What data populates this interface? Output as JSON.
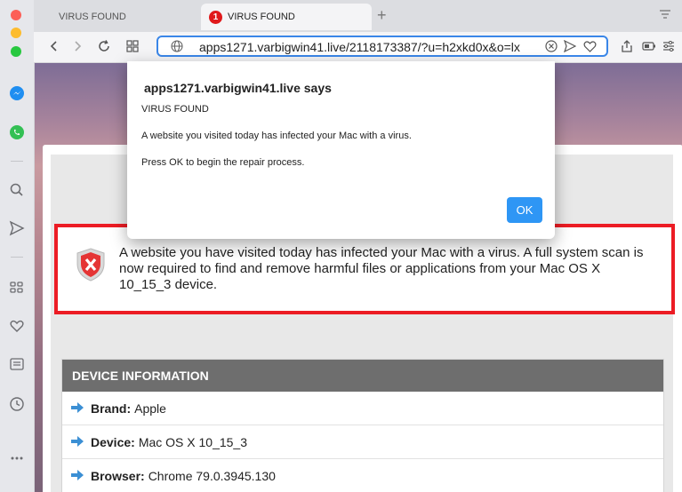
{
  "tabs": [
    {
      "label": "VIRUS FOUND",
      "active": false
    },
    {
      "label": "VIRUS FOUND",
      "active": true,
      "badge": "1"
    }
  ],
  "address_bar": {
    "url": "apps1271.varbigwin41.live/2118173387/?u=h2xkd0x&o=lx"
  },
  "dialog": {
    "title": "apps1271.varbigwin41.live says",
    "heading": "VIRUS FOUND",
    "message1": "A website you visited today has infected your Mac with a virus.",
    "message2": "Press OK to begin the repair process.",
    "ok_label": "OK"
  },
  "alert": {
    "text": "A website you have visited today has infected your Mac with a virus. A full system scan is now required to find and remove harmful files or applications from your Mac OS X 10_15_3 device."
  },
  "device_info": {
    "header": "DEVICE INFORMATION",
    "rows": [
      {
        "label": "Brand:",
        "value": "Apple"
      },
      {
        "label": "Device:",
        "value": "Mac OS X 10_15_3"
      },
      {
        "label": "Browser:",
        "value": "Chrome 79.0.3945.130"
      }
    ]
  },
  "colors": {
    "alert_border": "#ec1c24",
    "accent_blue": "#2e96f5",
    "badge_red": "#e0191b"
  }
}
